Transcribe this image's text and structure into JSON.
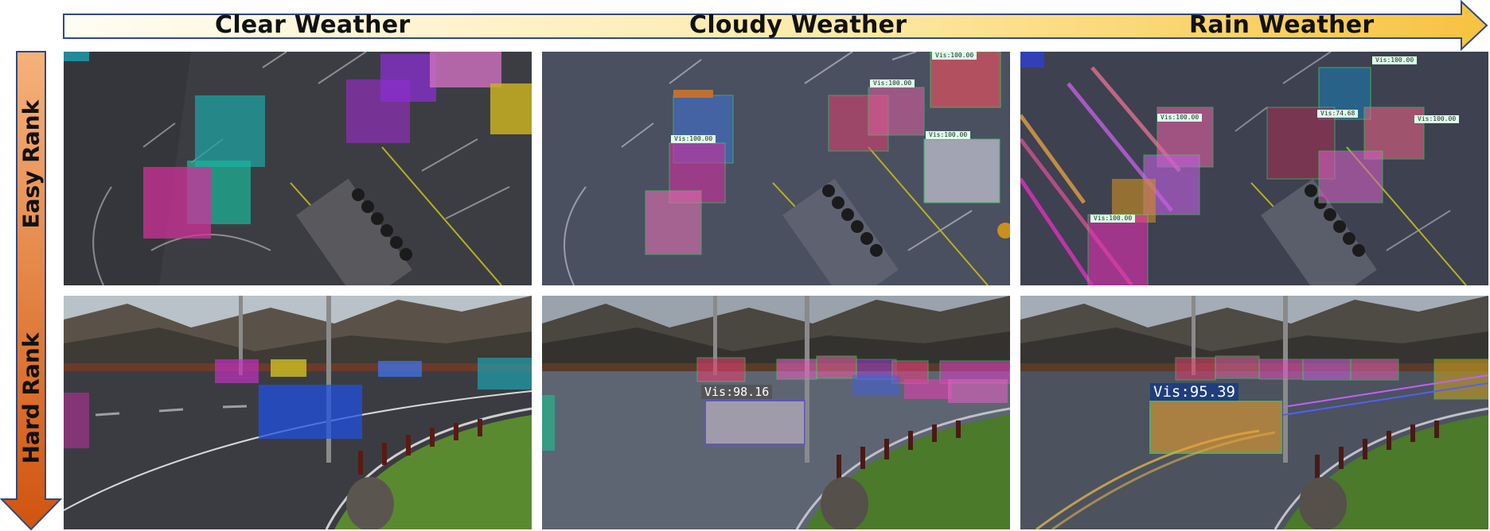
{
  "weather_axis": {
    "labels": [
      "Clear Weather",
      "Cloudy Weather",
      "Rain Weather"
    ],
    "gradient_start": "#fffdf3",
    "gradient_end": "#f8c240",
    "border_color": "#2e4a80"
  },
  "rank_axis": {
    "labels": [
      "Easy Rank",
      "Hard Rank"
    ],
    "gradient_start": "#f6b27a",
    "gradient_end": "#d0540e"
  },
  "panels": {
    "cloudy_easy_vis": [
      "Vis:100.00",
      "Vis:100.00",
      "Vis:100.00",
      "Vis:100.00"
    ],
    "rain_easy_vis": [
      "Vis:100.00",
      "Vis:74.68",
      "Vis:100.00",
      "Vis:100.00",
      "Vis:100.00"
    ],
    "cloudy_hard_vis": "Vis:98.16",
    "rain_hard_vis": "Vis:95.39"
  }
}
